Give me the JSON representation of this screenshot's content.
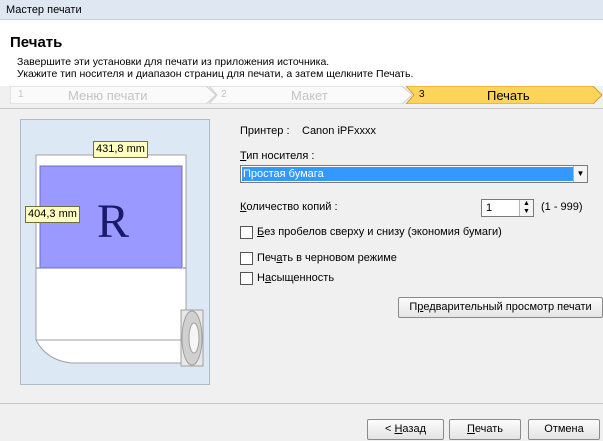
{
  "window": {
    "title": "Мастер печати"
  },
  "header": {
    "title": "Печать",
    "line1": "Завершите эти установки для печати из приложения источника.",
    "line2": "Укажите тип носителя и диапазон страниц для печати, а затем щелкните Печать."
  },
  "steps": [
    {
      "num": "1",
      "label": "Меню печати",
      "active": false
    },
    {
      "num": "2",
      "label": "Макет",
      "active": false
    },
    {
      "num": "3",
      "label": "Печать",
      "active": true
    }
  ],
  "preview": {
    "width_label": "431,8 mm",
    "height_label": "404,3 mm",
    "sample_letter": "R"
  },
  "printer": {
    "label": "Принтер :",
    "value": "Canon iPFxxxx"
  },
  "media_type": {
    "label_u": "Т",
    "label_rest": "ип носителя :",
    "selected": "Простая бумага"
  },
  "copies": {
    "label_u": "К",
    "label_rest": "оличество копий :",
    "value": "1",
    "range": "(1 - 999)"
  },
  "options": [
    {
      "u": "Б",
      "rest": "ез пробелов сверху и снизу (экономия бумаги)",
      "checked": false
    },
    {
      "pre": "Печ",
      "u": "а",
      "rest": "ть в черновом режиме",
      "checked": false
    },
    {
      "pre": "Н",
      "u": "а",
      "rest": "сыщенность",
      "checked": false
    }
  ],
  "preview_button": {
    "pre": "П",
    "u": "р",
    "rest": "едварительный просмотр печати"
  },
  "footer": {
    "back_pre": "< ",
    "back_u": "Н",
    "back_rest": "азад",
    "print_u": "П",
    "print_rest": "ечать",
    "cancel": "Отмена"
  },
  "colors": {
    "step_active": "#fcd45a",
    "preview_bg": "#dce9f5",
    "print_area": "#9999ff",
    "select_highlight": "#3399ff"
  }
}
